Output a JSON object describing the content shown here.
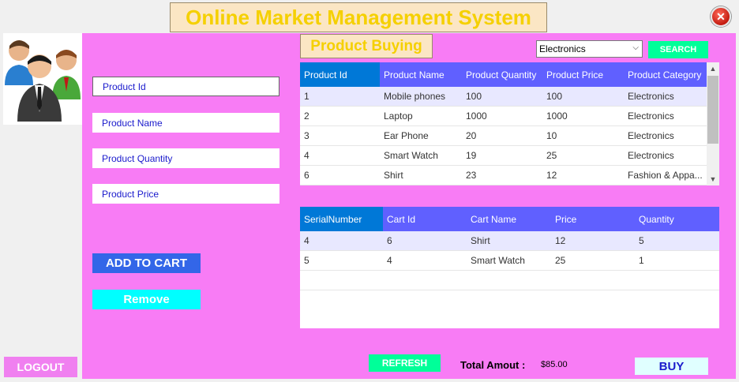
{
  "app": {
    "title": "Online Market Management System"
  },
  "section": {
    "title": "Product Buying"
  },
  "category_select": {
    "selected": "Electronics"
  },
  "search_label": "SEARCH",
  "fields": {
    "product_id": "Product Id",
    "product_name": "Product Name",
    "product_quantity": "Product Quantity",
    "product_price": "Product Price"
  },
  "buttons": {
    "add_to_cart": "ADD TO CART",
    "remove": "Remove",
    "logout": "LOGOUT",
    "refresh": "REFRESH",
    "buy": "BUY"
  },
  "products": {
    "columns": [
      "Product Id",
      "Product Name",
      "Product Quantity",
      "Product Price",
      "Product Category"
    ],
    "rows": [
      [
        "1",
        "Mobile phones",
        "100",
        "100",
        "Electronics"
      ],
      [
        "2",
        "Laptop",
        "1000",
        "1000",
        "Electronics"
      ],
      [
        "3",
        "Ear Phone",
        "20",
        "10",
        "Electronics"
      ],
      [
        "4",
        "Smart Watch",
        "19",
        "25",
        "Electronics"
      ],
      [
        "6",
        "Shirt",
        "23",
        "12",
        " Fashion & Appa..."
      ]
    ]
  },
  "cart": {
    "columns": [
      "SerialNumber",
      "Cart Id",
      "Cart Name",
      "Price",
      "Quantity"
    ],
    "rows": [
      [
        "4",
        "6",
        "Shirt",
        "12",
        "5"
      ],
      [
        "5",
        "4",
        "Smart Watch",
        "25",
        "1"
      ]
    ]
  },
  "total": {
    "label": "Total Amout :",
    "value": "$85.00"
  },
  "colors": {
    "panel": "#f87cf5",
    "title_text": "#f5d000",
    "header": "#6060ff",
    "header_first": "#0078d7",
    "add_button": "#3366e8",
    "remove_button": "#00ffff",
    "search_button": "#00ff99"
  },
  "icons": {
    "close": "close-icon",
    "avatar": "users-group-icon",
    "dropdown": "chevron-down-icon"
  }
}
